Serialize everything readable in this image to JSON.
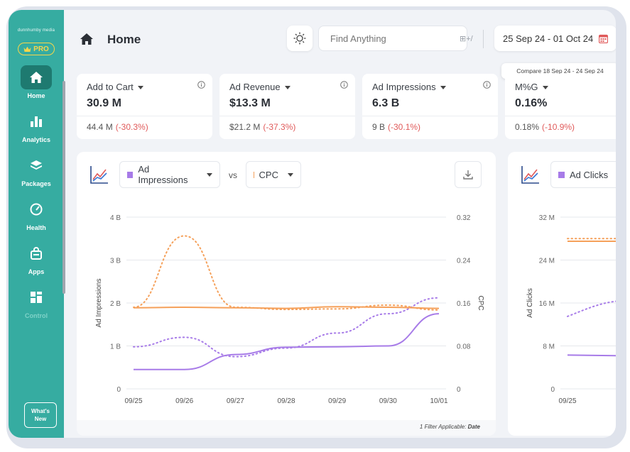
{
  "sidebar": {
    "brand": "dunnhumby media",
    "pro_label": "PRO",
    "items": [
      {
        "label": "Home",
        "icon": "home-icon",
        "active": true
      },
      {
        "label": "Analytics",
        "icon": "bar-chart-icon"
      },
      {
        "label": "Packages",
        "icon": "layers-icon"
      },
      {
        "label": "Health",
        "icon": "gauge-icon"
      },
      {
        "label": "Apps",
        "icon": "basket-icon"
      },
      {
        "label": "Control",
        "icon": "grid-icon"
      }
    ],
    "whats_new": "What's New"
  },
  "header": {
    "title": "Home",
    "search_placeholder": "Find Anything",
    "search_shortcut": "⊞+/",
    "date_range": "25 Sep 24 - 01 Oct 24",
    "compare": "Compare 18 Sep 24 - 24 Sep 24"
  },
  "kpis": [
    {
      "name": "Add to Cart",
      "value": "30.9 M",
      "prev": "44.4 M",
      "change": "(-30.3%)"
    },
    {
      "name": "Ad Revenue",
      "value": "$13.3 M",
      "prev": "$21.2 M",
      "change": "(-37.3%)"
    },
    {
      "name": "Ad Impressions",
      "value": "6.3 B",
      "prev": "9 B",
      "change": "(-30.1%)"
    },
    {
      "name": "M%G",
      "value": "0.16%",
      "prev": "0.18%",
      "change": "(-10.9%)"
    }
  ],
  "colors": {
    "sidebar": "#36aca1",
    "purple": "#a77be8",
    "orange": "#f5a05a",
    "negative": "#e05a5a"
  },
  "chart1": {
    "metric1": "Ad Impressions",
    "vs": "vs",
    "metric2": "CPC",
    "footer_prefix": "1 Filter Applicable:",
    "footer_value": "Date"
  },
  "chart2": {
    "metric1": "Ad Clicks"
  },
  "chart_data": [
    {
      "type": "line",
      "title": "",
      "xlabel": "",
      "ylabel": "Ad Impressions",
      "y2label": "CPC",
      "x": [
        "09/25",
        "09/26",
        "09/27",
        "09/28",
        "09/29",
        "09/30",
        "10/01"
      ],
      "ylim": [
        0,
        4
      ],
      "y_ticks": [
        "0",
        "1 B",
        "2 B",
        "3 B",
        "4 B"
      ],
      "y2lim": [
        0,
        0.32
      ],
      "y2_ticks": [
        "0",
        "0.08",
        "0.16",
        "0.24",
        "0.32"
      ],
      "grid": true,
      "series": [
        {
          "metric": "Ad Impressions",
          "period": "current",
          "axis": "left",
          "values": [
            0.45,
            0.45,
            0.8,
            0.97,
            0.98,
            1.0,
            1.75
          ],
          "unit": "B"
        },
        {
          "metric": "Ad Impressions",
          "period": "compare",
          "axis": "left",
          "values": [
            0.98,
            1.2,
            0.75,
            0.95,
            1.3,
            1.75,
            2.12
          ],
          "unit": "B"
        },
        {
          "metric": "CPC",
          "period": "current",
          "axis": "right",
          "values": [
            0.151,
            0.152,
            0.151,
            0.15,
            0.153,
            0.152,
            0.15
          ]
        },
        {
          "metric": "CPC",
          "period": "compare",
          "axis": "right",
          "values": [
            0.152,
            0.285,
            0.152,
            0.148,
            0.149,
            0.156,
            0.147
          ]
        }
      ]
    },
    {
      "type": "line",
      "title": "",
      "xlabel": "",
      "ylabel": "Ad Clicks",
      "x": [
        "09/25"
      ],
      "ylim": [
        0,
        32
      ],
      "y_ticks": [
        "0",
        "8 M",
        "16 M",
        "24 M",
        "32 M"
      ],
      "grid": true,
      "series": [
        {
          "metric": "Ad Clicks",
          "period": "current",
          "values": [
            6.3
          ],
          "unit": "M"
        },
        {
          "metric": "Ad Clicks",
          "period": "compare",
          "values": [
            13.5
          ],
          "unit": "M"
        },
        {
          "metric": "CPC",
          "period": "current",
          "values": [
            27.5
          ]
        },
        {
          "metric": "CPC",
          "period": "compare",
          "values": [
            28.0
          ]
        }
      ]
    }
  ]
}
